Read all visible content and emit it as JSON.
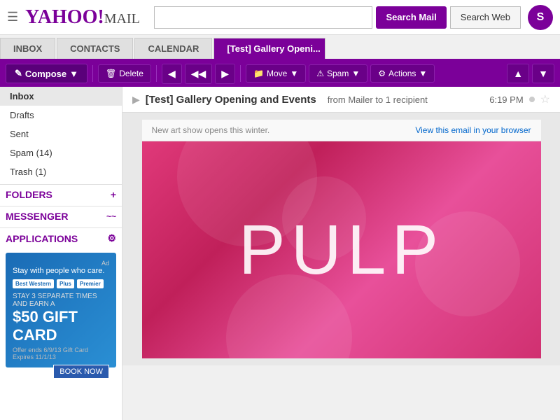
{
  "header": {
    "logo": "YAHOO!",
    "logo_mail": "MAIL",
    "search_placeholder": "",
    "search_mail_label": "Search Mail",
    "search_web_label": "Search Web",
    "user_initial": "S"
  },
  "tabs": [
    {
      "id": "inbox",
      "label": "INBOX",
      "active": false
    },
    {
      "id": "contacts",
      "label": "CONTACTS",
      "active": false
    },
    {
      "id": "calendar",
      "label": "CALENDAR",
      "active": false
    },
    {
      "id": "email",
      "label": "[Test] Gallery Openi...",
      "active": true
    }
  ],
  "toolbar": {
    "compose_label": "Compose",
    "delete_label": "Delete",
    "move_label": "Move",
    "spam_label": "Spam",
    "actions_label": "Actions"
  },
  "sidebar": {
    "items": [
      {
        "id": "inbox",
        "label": "Inbox",
        "active": true,
        "count": null
      },
      {
        "id": "drafts",
        "label": "Drafts",
        "active": false,
        "count": null
      },
      {
        "id": "sent",
        "label": "Sent",
        "active": false,
        "count": null
      },
      {
        "id": "spam",
        "label": "Spam (14)",
        "active": false,
        "count": "14"
      },
      {
        "id": "trash",
        "label": "Trash (1)",
        "active": false,
        "count": "1"
      }
    ],
    "sections": [
      {
        "id": "folders",
        "label": "FOLDERS"
      },
      {
        "id": "messenger",
        "label": "MESSENGER"
      },
      {
        "id": "applications",
        "label": "APPLICATIONS"
      }
    ]
  },
  "ad": {
    "tagline": "Stay with people who care.",
    "hotels": [
      "Best Western",
      "Best Western Plus",
      "Best Western Premier"
    ],
    "stay_text": "STAY 3 SEPARATE TIMES AND EARN A",
    "amount": "$50 GIFT CARD",
    "fine_print": "Offer ends 6/9/13\nGift Card Expires 11/1/13",
    "book_label": "BOOK NOW"
  },
  "email": {
    "subject": "[Test] Gallery Opening and Events",
    "from": "from Mailer to 1 recipient",
    "time": "6:19 PM",
    "notice_text": "New art show opens this  winter.",
    "view_browser_label": "View this email in your browser",
    "pulp_text": "PULP"
  }
}
